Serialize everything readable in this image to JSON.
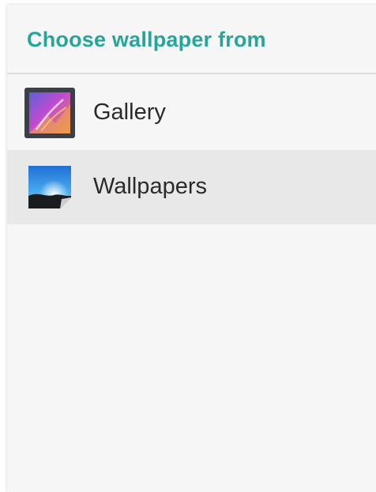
{
  "dialog": {
    "title": "Choose wallpaper from",
    "title_color": "#26a69a",
    "items": [
      {
        "label": "Gallery",
        "icon": "gallery-icon",
        "selected": false
      },
      {
        "label": "Wallpapers",
        "icon": "wallpapers-icon",
        "selected": true
      }
    ]
  }
}
